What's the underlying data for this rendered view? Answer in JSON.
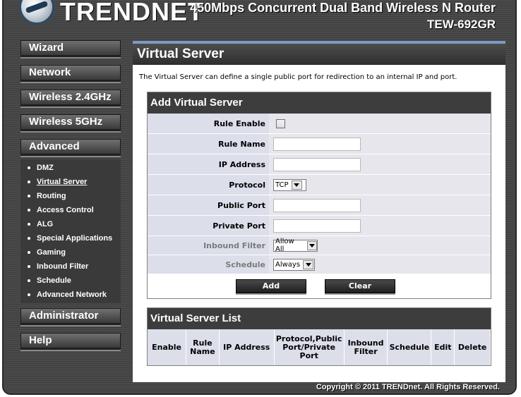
{
  "header": {
    "brand": "TRENDNET",
    "product_title": "450Mbps Concurrent Dual Band Wireless N Router",
    "model": "TEW-692GR"
  },
  "menu": {
    "wizard": "Wizard",
    "network": "Network",
    "wireless24": "Wireless 2.4GHz",
    "wireless5": "Wireless 5GHz",
    "advanced": "Advanced",
    "advanced_items": [
      "DMZ",
      "Virtual Server",
      "Routing",
      "Access Control",
      "ALG",
      "Special Applications",
      "Gaming",
      "Inbound Filter",
      "Schedule",
      "Advanced Network"
    ],
    "administrator": "Administrator",
    "help": "Help"
  },
  "content": {
    "title": "Virtual Server",
    "intro": "The Virtual Server can define a single public port for redirection to an internal IP and port."
  },
  "add_panel": {
    "title": "Add Virtual Server",
    "rule_enable_label": "Rule Enable",
    "rule_enable_checked": false,
    "rule_name_label": "Rule Name",
    "rule_name_value": "",
    "ip_address_label": "IP Address",
    "ip_address_value": "",
    "protocol_label": "Protocol",
    "protocol_value": "TCP",
    "public_port_label": "Public Port",
    "public_port_value": "",
    "private_port_label": "Private Port",
    "private_port_value": "",
    "inbound_filter_label": "Inbound Filter",
    "inbound_filter_value": "Allow All",
    "schedule_label": "Schedule",
    "schedule_value": "Always",
    "add_button": "Add",
    "clear_button": "Clear"
  },
  "list_panel": {
    "title": "Virtual Server List",
    "columns": [
      "Enable",
      "Rule Name",
      "IP Address",
      "Protocol,Public Port/Private Port",
      "Inbound Filter",
      "Schedule",
      "Edit",
      "Delete"
    ]
  },
  "footer": {
    "copyright": "Copyright © 2011 TRENDnet. All Rights Reserved."
  }
}
